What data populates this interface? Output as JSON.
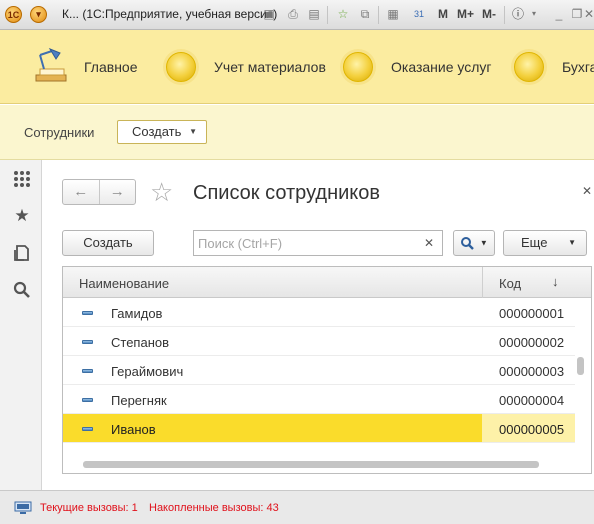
{
  "titlebar": {
    "title": "К...  (1С:Предприятие, учебная версия)",
    "m_label": "M",
    "m_plus_label": "M+",
    "m_minus_label": "M-",
    "calendar_label": "31"
  },
  "sections": {
    "items": [
      {
        "label": "Главное"
      },
      {
        "label": "Учет материалов"
      },
      {
        "label": "Оказание услуг"
      },
      {
        "label": "Бухга"
      }
    ]
  },
  "command_bar": {
    "section_label": "Сотрудники",
    "create_label": "Создать"
  },
  "form": {
    "title": "Список сотрудников",
    "create_label": "Создать",
    "search_placeholder": "Поиск (Ctrl+F)",
    "more_label": "Еще"
  },
  "table": {
    "columns": [
      "Наименование",
      "Код"
    ],
    "sort_indicator": "↓",
    "rows": [
      {
        "name": "Гамидов",
        "code": "000000001"
      },
      {
        "name": "Степанов",
        "code": "000000002"
      },
      {
        "name": "Гераймович",
        "code": "000000003"
      },
      {
        "name": "Перегняк",
        "code": "000000004"
      },
      {
        "name": "Иванов",
        "code": "000000005",
        "selected": true
      }
    ]
  },
  "status": {
    "current_calls": "Текущие вызовы: 1",
    "accumulated_calls": "Накопленные вызовы: 43"
  },
  "colors": {
    "sections_bg": "#fbeca0",
    "command_bar_bg": "#fbf6cf",
    "selected_row": "#fadc2b",
    "status_text": "#e0111b"
  }
}
